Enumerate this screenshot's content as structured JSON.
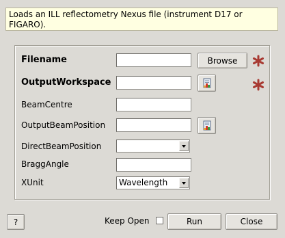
{
  "description": "Loads an ILL reflectometry Nexus file (instrument D17 or FIGARO).",
  "fields": [
    {
      "label": "Filename",
      "value": "",
      "required": true
    },
    {
      "label": "OutputWorkspace",
      "value": "",
      "required": true
    },
    {
      "label": "BeamCentre",
      "value": ""
    },
    {
      "label": "OutputBeamPosition",
      "value": ""
    },
    {
      "label": "DirectBeamPosition",
      "value": ""
    },
    {
      "label": "BraggAngle",
      "value": ""
    },
    {
      "label": "XUnit",
      "value": "Wavelength"
    }
  ],
  "buttons": {
    "browse": "Browse",
    "help": "?",
    "keep_open": "Keep Open",
    "keep_open_checked": false,
    "run": "Run",
    "close": "Close"
  },
  "colors": {
    "required_star": "#a83a32",
    "description_bg": "#ffffe1",
    "window_bg": "#dcdad5"
  },
  "icons": {
    "workspace_button": "workspace-icon",
    "required_marker": "asterisk-icon"
  }
}
